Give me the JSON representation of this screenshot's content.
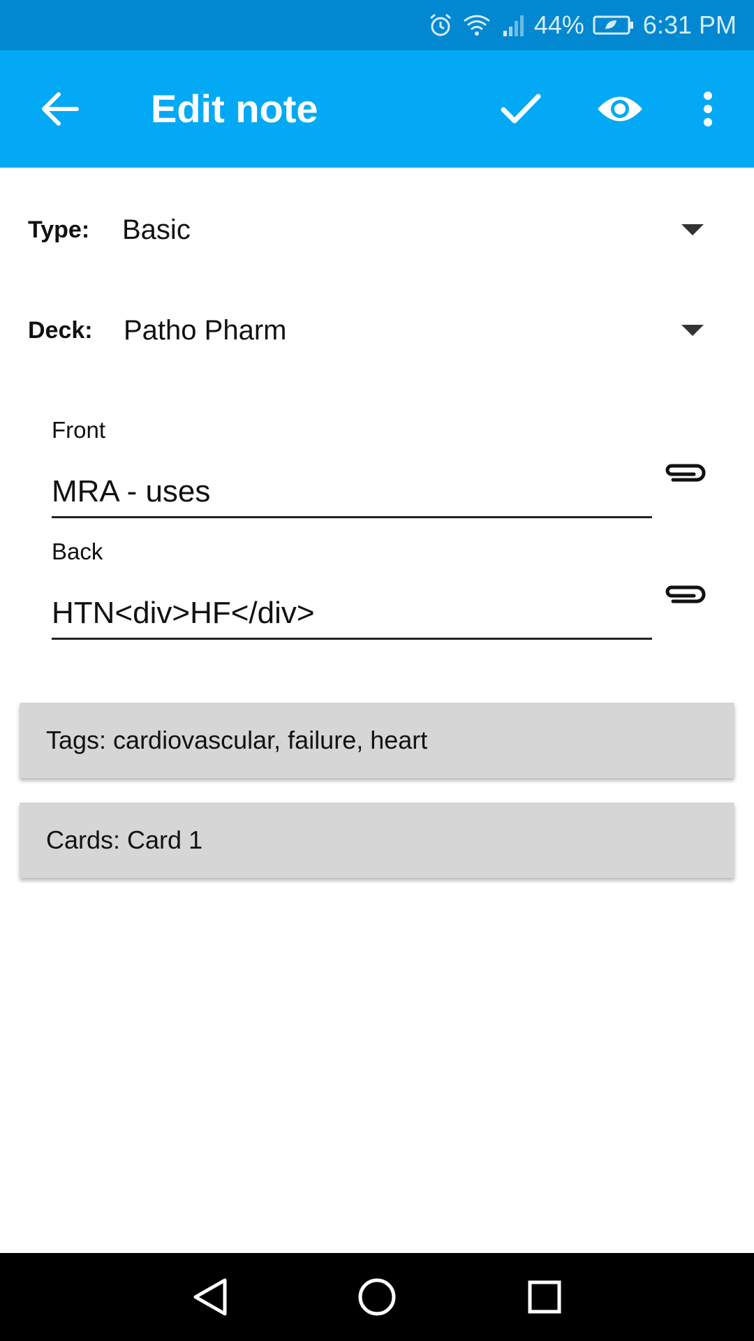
{
  "status_bar": {
    "battery_percent": "44%",
    "time": "6:31 PM",
    "color": "#0288d1",
    "icons": [
      "alarm-icon",
      "wifi-icon",
      "signal-icon",
      "battery-saver-icon"
    ]
  },
  "app_bar": {
    "title": "Edit note",
    "color": "#03a9f4",
    "icons": [
      "back-arrow-icon",
      "checkmark-icon",
      "eye-icon",
      "overflow-menu-icon"
    ]
  },
  "note_type": {
    "label": "Type:",
    "value": "Basic"
  },
  "deck": {
    "label": "Deck:",
    "value": "Patho Pharm"
  },
  "fields": {
    "front": {
      "label": "Front",
      "value": "MRA - uses"
    },
    "back": {
      "label": "Back",
      "value": "HTN<div>HF</div>"
    }
  },
  "tags": {
    "text": "Tags: cardiovascular, failure, heart"
  },
  "cards": {
    "text": "Cards: Card 1"
  },
  "nav_bar": {
    "icons": [
      "back-triangle-icon",
      "home-circle-icon",
      "recents-square-icon"
    ]
  }
}
